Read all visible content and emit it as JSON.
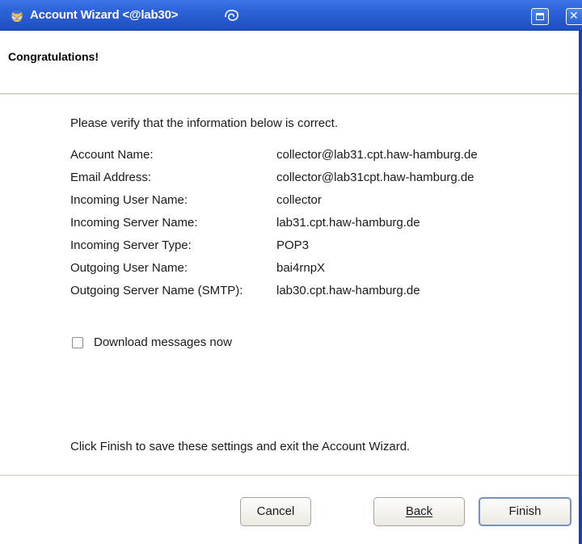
{
  "window": {
    "title": "Account Wizard <@lab30>",
    "icons": {
      "app": "thunderbird-icon",
      "swirl": "swirl-icon",
      "maximize": "maximize-icon",
      "close": "close-icon"
    },
    "close_glyph": "✕"
  },
  "header": {
    "title": "Congratulations!"
  },
  "content": {
    "intro": "Please verify that the information below is correct.",
    "rows": [
      {
        "label": "Account Name:",
        "value": "collector@lab31.cpt.haw-hamburg.de"
      },
      {
        "label": "Email Address:",
        "value": "collector@lab31cpt.haw-hamburg.de"
      },
      {
        "label": "Incoming User Name:",
        "value": "collector"
      },
      {
        "label": "Incoming Server Name:",
        "value": "lab31.cpt.haw-hamburg.de"
      },
      {
        "label": "Incoming Server Type:",
        "value": "POP3"
      },
      {
        "label": "Outgoing User Name:",
        "value": "bai4rnpX"
      },
      {
        "label": "Outgoing Server Name (SMTP):",
        "value": "lab30.cpt.haw-hamburg.de"
      }
    ],
    "download_checkbox": {
      "label": "Download messages now",
      "checked": false
    },
    "finish_note": "Click Finish to save these settings and exit the Account Wizard."
  },
  "buttons": {
    "cancel": "Cancel",
    "back": "Back",
    "finish": "Finish"
  },
  "colors": {
    "titlebar": "#2a5fd6",
    "finish_border": "#7891c4"
  }
}
